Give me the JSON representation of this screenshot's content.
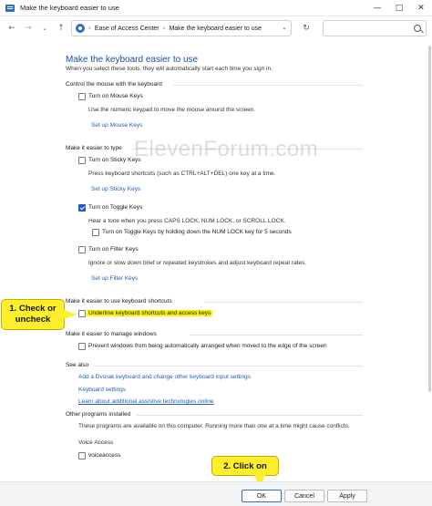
{
  "window": {
    "title": "Make the keyboard easier to use",
    "minimize": "—",
    "maximize": "□",
    "close": "✕"
  },
  "address": {
    "crumbs": [
      "Ease of Access Center",
      "Make the keyboard easier to use"
    ],
    "search_placeholder": "",
    "icons": {
      "back": "left-arrow-icon",
      "forward": "right-arrow-icon",
      "recent": "chevron-down-icon",
      "up": "up-arrow-icon",
      "refresh": "refresh-icon",
      "search": "search-icon"
    }
  },
  "page": {
    "title": "Make the keyboard easier to use",
    "subtitle": "When you select these tools, they will automatically start each time you sign in."
  },
  "sections": {
    "mouse": {
      "heading": "Control the mouse with the keyboard",
      "mouse_keys": {
        "label": "Turn on Mouse Keys",
        "checked": false
      },
      "mouse_keys_desc": "Use the numeric keypad to move the mouse around the screen.",
      "mouse_keys_link": "Set up Mouse Keys"
    },
    "type": {
      "heading": "Make it easier to type",
      "sticky": {
        "label": "Turn on Sticky Keys",
        "checked": false
      },
      "sticky_desc": "Press keyboard shortcuts (such as CTRL+ALT+DEL) one key at a time.",
      "sticky_link": "Set up Sticky Keys",
      "toggle": {
        "label": "Turn on Toggle Keys",
        "checked": true
      },
      "toggle_desc": "Hear a tone when you press CAPS LOCK, NUM LOCK, or SCROLL LOCK.",
      "toggle_hold": {
        "label": "Turn on Toggle Keys by holding down the NUM LOCK key for 5 seconds",
        "checked": false
      },
      "filter": {
        "label": "Turn on Filter Keys",
        "checked": false
      },
      "filter_desc": "Ignore or slow down brief or repeated keystrokes and adjust keyboard repeat rates.",
      "filter_link": "Set up Filter Keys"
    },
    "shortcuts": {
      "heading": "Make it easier to use keyboard shortcuts",
      "underline": {
        "label": "Underline keyboard shortcuts and access keys",
        "checked": false
      }
    },
    "windows": {
      "heading": "Make it easier to manage windows",
      "prevent": {
        "label": "Prevent windows from being automatically arranged when moved to the edge of the screen",
        "checked": false
      }
    },
    "see_also": {
      "heading": "See also",
      "links": [
        "Add a Dvorak keyboard and change other keyboard input settings",
        "Keyboard settings",
        "Learn about additional assistive technologies online"
      ]
    },
    "other": {
      "heading": "Other programs installed",
      "desc": "These programs are available on this computer. Running more than one at a time might cause conflicts.",
      "group": "Voice Access",
      "voiceaccess": {
        "label": "voiceaccess",
        "checked": false
      }
    }
  },
  "watermark": "ElevenForum.com",
  "callouts": {
    "step1": "1. Check or uncheck",
    "step2": "2. Click on"
  },
  "buttons": {
    "ok": "OK",
    "cancel": "Cancel",
    "apply": "Apply"
  },
  "colors": {
    "accent": "#1f5bc6",
    "link": "#1e5fb8",
    "heading": "#1b4ea0",
    "highlight": "#fff200",
    "callout": "#ffee2a"
  }
}
